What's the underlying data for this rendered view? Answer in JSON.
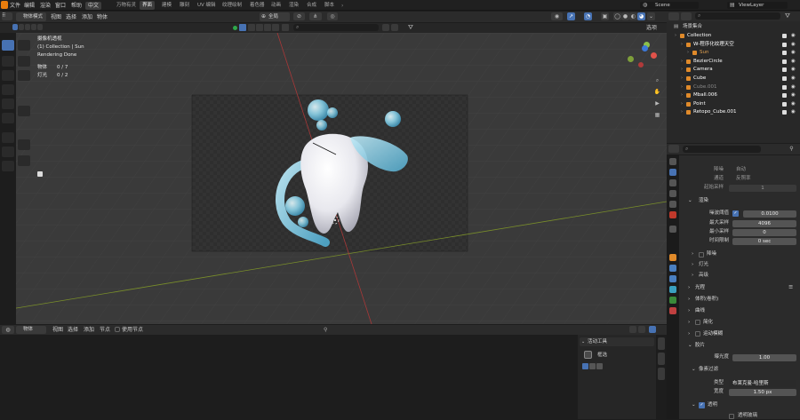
{
  "menu": [
    "文件",
    "编辑",
    "渲染",
    "窗口",
    "帮助",
    "中文"
  ],
  "workspaces": [
    "万物有灵",
    "界面",
    "建模",
    "雕刻",
    "UV 编辑",
    "纹理绘制",
    "着色器",
    "动画",
    "渲染",
    "合成",
    "脚本"
  ],
  "active_workspace": "界面",
  "scene": {
    "label": "Scene",
    "view_layer": "ViewLayer"
  },
  "viewport_header": {
    "mode": "物体模式",
    "menus": [
      "视图",
      "选择",
      "添加",
      "物体"
    ],
    "transform": "全局",
    "options": "选项"
  },
  "overlay_text": [
    "摄像机透视",
    "(1) Collection | Sun",
    "Rendering Done"
  ],
  "stats": [
    {
      "label": "物体",
      "value": "0 / 7"
    },
    {
      "label": "灯光",
      "value": "0 / 2"
    }
  ],
  "outliner": {
    "title": "场景集合",
    "items": [
      {
        "name": "Collection",
        "indent": 1,
        "color": "#ffffff"
      },
      {
        "name": "W-程序化纹理天空",
        "indent": 2,
        "color": "#ffffff"
      },
      {
        "name": "Sun",
        "indent": 3,
        "color": "#e0a050"
      },
      {
        "name": "BezierCircle",
        "indent": 2,
        "color": "#ffffff"
      },
      {
        "name": "Camera",
        "indent": 2,
        "color": "#ffffff"
      },
      {
        "name": "Cube",
        "indent": 2,
        "color": "#ffffff"
      },
      {
        "name": "Cube.001",
        "indent": 2,
        "color": "#8a8a8a"
      },
      {
        "name": "Mball.006",
        "indent": 2,
        "color": "#ffffff"
      },
      {
        "name": "Point",
        "indent": 2,
        "color": "#ffffff"
      },
      {
        "name": "Retopo_Cube.001",
        "indent": 2,
        "color": "#ffffff"
      }
    ]
  },
  "properties": {
    "rows_top": [
      {
        "label": "降噪",
        "value": "自动"
      },
      {
        "label": "通道",
        "value": "反照率"
      },
      {
        "label": "起始采样",
        "value": "1"
      }
    ],
    "render_panel": "渲染",
    "noise_threshold_label": "噪波阈值",
    "noise_threshold": "0.0100",
    "max_samples_label": "最大采样",
    "max_samples": "4096",
    "min_samples_label": "最小采样",
    "min_samples": "0",
    "time_limit_label": "时间限制",
    "time_limit": "0 sec",
    "subpanels": [
      "降噪",
      "灯光",
      "高级"
    ],
    "sections": [
      "光程",
      "体积(卷积)",
      "曲线",
      "简化",
      "运动模糊"
    ],
    "film": "胶片",
    "exposure_label": "曝光度",
    "exposure": "1.00",
    "pixel_filter": "像素过滤",
    "filter_type_label": "类型",
    "filter_type": "布莱克曼-哈里斯",
    "width_label": "宽度",
    "width": "1.50 px",
    "transparent": "透明",
    "transparent_glass": "透明玻璃"
  },
  "bottom_header": {
    "mode": "物体",
    "menus": [
      "视图",
      "选择",
      "添加",
      "节点",
      "使用节点"
    ]
  },
  "active_tool": {
    "title": "活动工具",
    "tool": "框选"
  }
}
